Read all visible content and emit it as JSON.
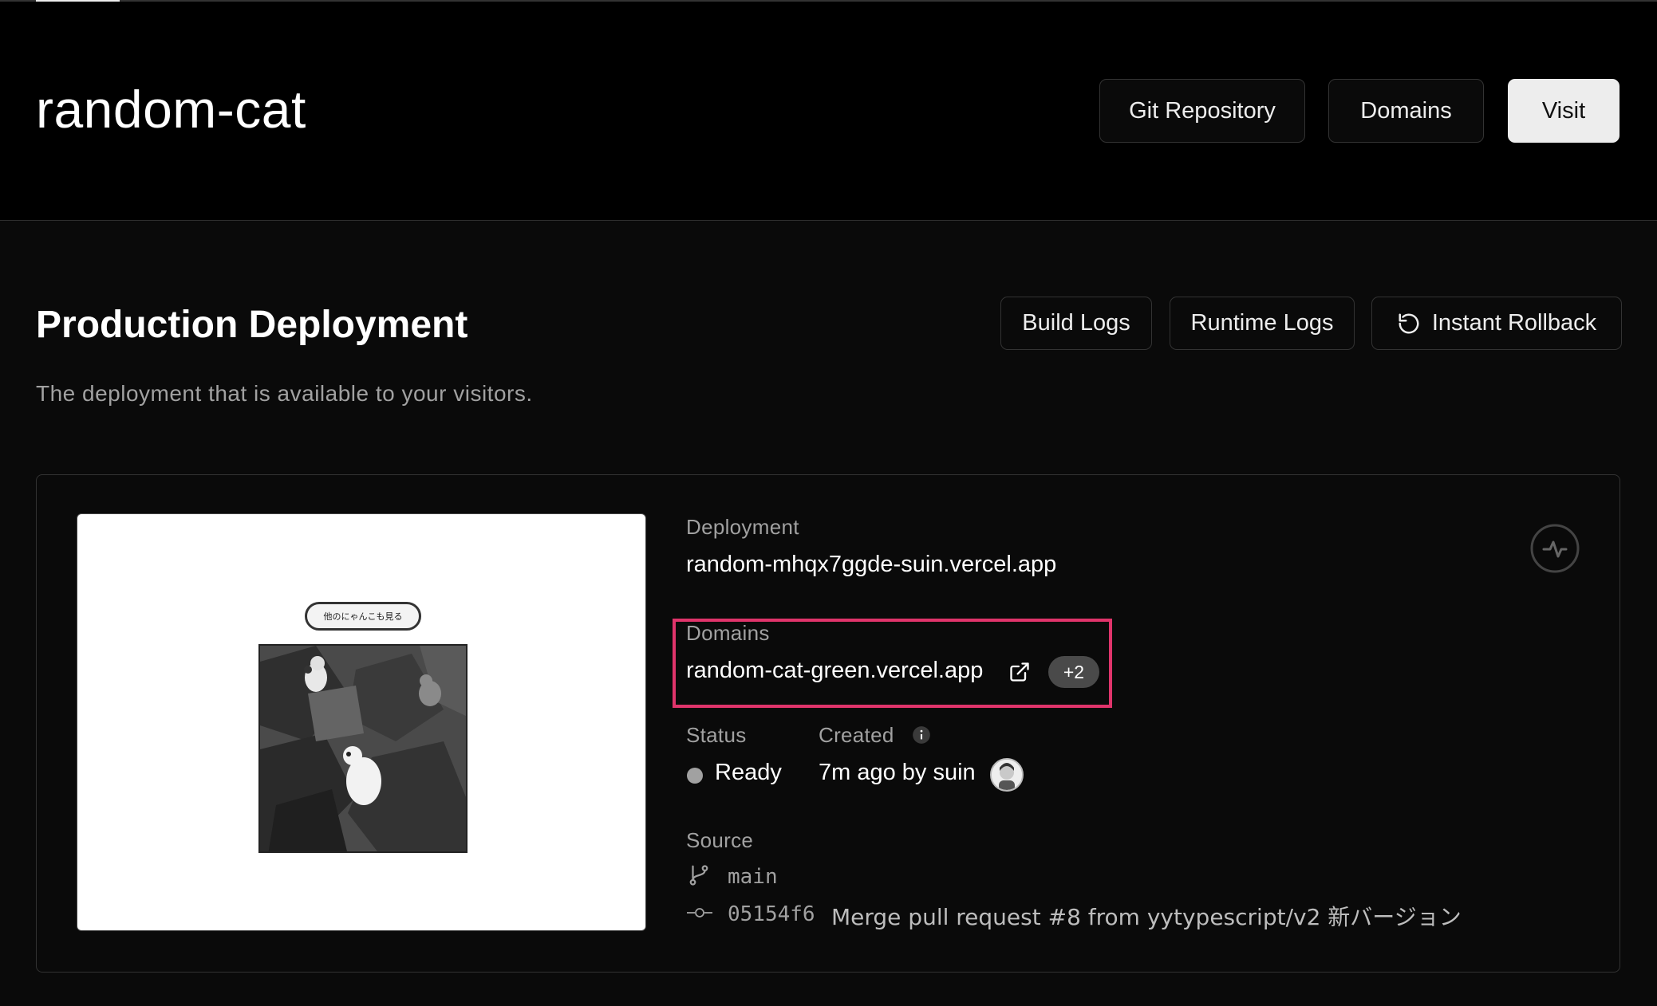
{
  "project": {
    "title": "random-cat",
    "buttons": {
      "git": "Git Repository",
      "domains": "Domains",
      "visit": "Visit"
    }
  },
  "section": {
    "title": "Production Deployment",
    "description": "The deployment that is available to your visitors.",
    "buttons": {
      "build_logs": "Build Logs",
      "runtime_logs": "Runtime Logs",
      "rollback": "Instant Rollback"
    }
  },
  "deployment": {
    "label": "Deployment",
    "url": "random-mhqx7ggde-suin.vercel.app",
    "preview_banner": "他のにゃんこも見る",
    "domains_label": "Domains",
    "domain": "random-cat-green.vercel.app",
    "domain_extra": "+2",
    "status_label": "Status",
    "status": "Ready",
    "created_label": "Created",
    "created": "7m ago by suin",
    "source_label": "Source",
    "branch": "main",
    "commit_hash": "05154f6",
    "commit_message": "Merge pull request #8 from yytypescript/v2 新バージョン"
  },
  "colors": {
    "highlight": "#e0346b",
    "background": "#0a0a0a",
    "status": "#a1a1a1"
  },
  "icons": [
    "rollback-icon",
    "activity-icon",
    "external-link-icon",
    "info-icon",
    "branch-icon",
    "commit-icon"
  ]
}
